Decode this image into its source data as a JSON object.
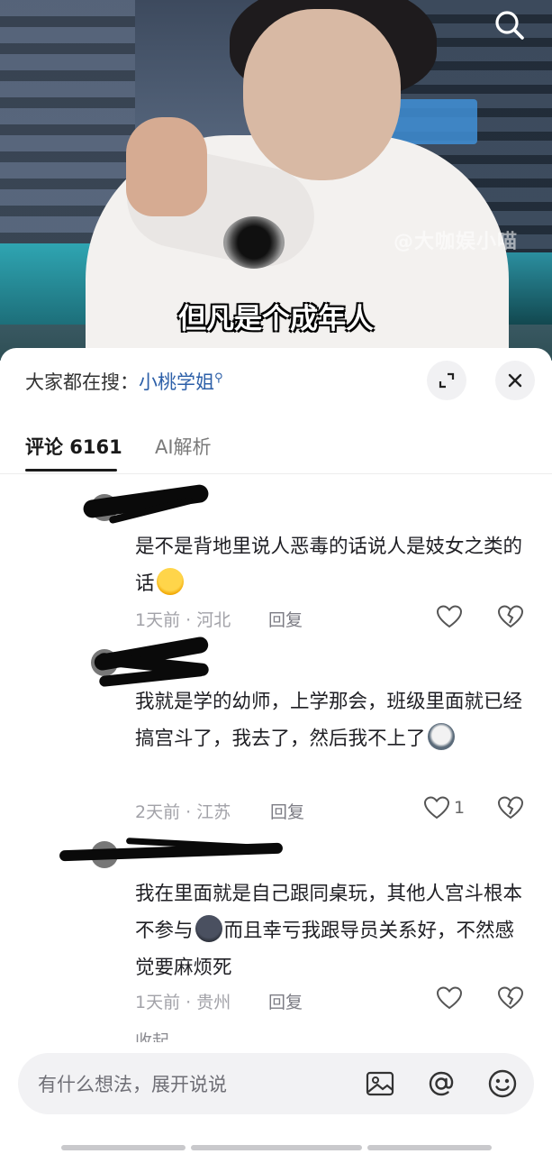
{
  "video": {
    "subtitle": "但凡是个成年人",
    "watermark": "@大咖娱小喵",
    "search_icon": "search-icon"
  },
  "hot_search": {
    "prefix": "大家都在搜：",
    "keyword": "小桃学姐",
    "keyword_icon": "search-small-icon"
  },
  "tabs": [
    {
      "label": "评论 6161",
      "active": true
    },
    {
      "label": "AI解析",
      "active": false
    }
  ],
  "comments": [
    {
      "text": "是不是背地里说人恶毒的话说人是妓女之类的话",
      "emoji": "laughing-crying-emoji",
      "time": "1天前 · 河北",
      "reply_label": "回复",
      "likes": ""
    },
    {
      "text": "我就是学的幼师，上学那会，班级里面就已经搞宫斗了，我去了，然后我不上了",
      "emoji": "husky-emoji",
      "time": "2天前 · 江苏",
      "reply_label": "回复",
      "likes": "1"
    },
    {
      "text_before": "我在里面就是自己跟同桌玩，其他人宫斗根本不参与",
      "emoji": "dark-face-emoji",
      "text_after": "而且幸亏我跟导员关系好，不然感觉要麻烦死",
      "time": "1天前 · 贵州",
      "reply_label": "回复",
      "likes": ""
    }
  ],
  "collapse_label": "收起",
  "input": {
    "placeholder": "有什么想法，展开说说"
  },
  "colors": {
    "keyword_blue": "#2c5fa8",
    "meta_gray": "#a2a2a8",
    "text_dark": "#1f1f24"
  }
}
